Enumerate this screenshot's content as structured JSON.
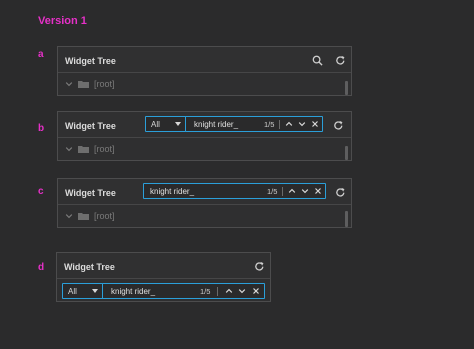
{
  "version_title": "Version 1",
  "variants": [
    {
      "label": "a"
    },
    {
      "label": "b"
    },
    {
      "label": "c"
    },
    {
      "label": "d"
    }
  ],
  "panel_title": "Widget Tree",
  "tree": {
    "root_label": "[root]"
  },
  "search": {
    "filter_value": "All",
    "query": "knight rider_",
    "count": "1/5"
  },
  "icons": {
    "search": "search-icon",
    "refresh": "refresh-icon",
    "prev": "chevron-up-icon",
    "next": "chevron-down-icon",
    "close": "close-icon",
    "expand": "chevron-down-icon",
    "folder": "folder-icon",
    "dropdown": "caret-down-icon"
  },
  "colors": {
    "accent": "#e630c8",
    "focus_border": "#2b9fd9",
    "background": "#2b2b2c",
    "panel": "#2f2f30"
  }
}
